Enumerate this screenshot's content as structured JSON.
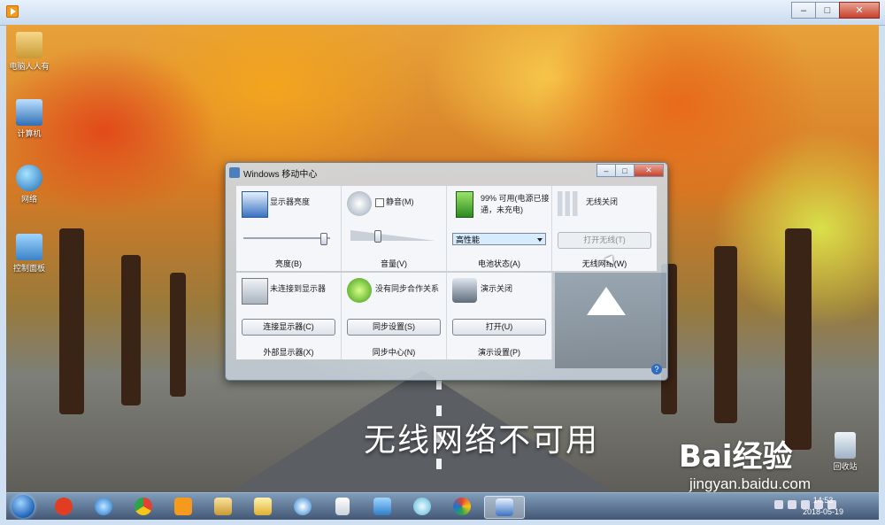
{
  "desktop_icons": [
    {
      "label": "电脑人人有"
    },
    {
      "label": "计算机"
    },
    {
      "label": "网络"
    },
    {
      "label": "控制面板"
    },
    {
      "label": "回收站"
    }
  ],
  "dialog": {
    "title": "Windows 移动中心",
    "tiles": {
      "display": {
        "label": "显示器亮度",
        "footer": "亮度(B)",
        "brightness_level": 0.95
      },
      "volume": {
        "mute_label": "静音(M)",
        "muted": false,
        "footer": "音量(V)",
        "volume_level": 0.3
      },
      "battery": {
        "status": "99% 可用(电源已接通，未充电)",
        "plan": "高性能",
        "footer": "电池状态(A)"
      },
      "wireless": {
        "status": "无线关闭",
        "button": "打开无线(T)",
        "footer": "无线网络(W)"
      },
      "external_display": {
        "status": "未连接到显示器",
        "button": "连接显示器(C)",
        "footer": "外部显示器(X)"
      },
      "sync": {
        "status": "没有同步合作关系",
        "button": "同步设置(S)",
        "footer": "同步中心(N)"
      },
      "presentation": {
        "status": "演示关闭",
        "button": "打开(U)",
        "footer": "演示设置(P)"
      }
    },
    "help": "?"
  },
  "caption": "无线网络不可用",
  "watermark": {
    "logo": "Bai经验",
    "url": "jingyan.baidu.com"
  },
  "taskbar": {
    "apps": [
      "start",
      "jiang",
      "ie",
      "chrome",
      "media",
      "explorer",
      "folder",
      "paint",
      "doc",
      "projector",
      "gear",
      "palette",
      "mobility-center"
    ],
    "clock_time": "14:53",
    "clock_date": "2018-05-19"
  },
  "colors": {
    "accent": "#2064b8",
    "close_red": "#c7412c"
  }
}
